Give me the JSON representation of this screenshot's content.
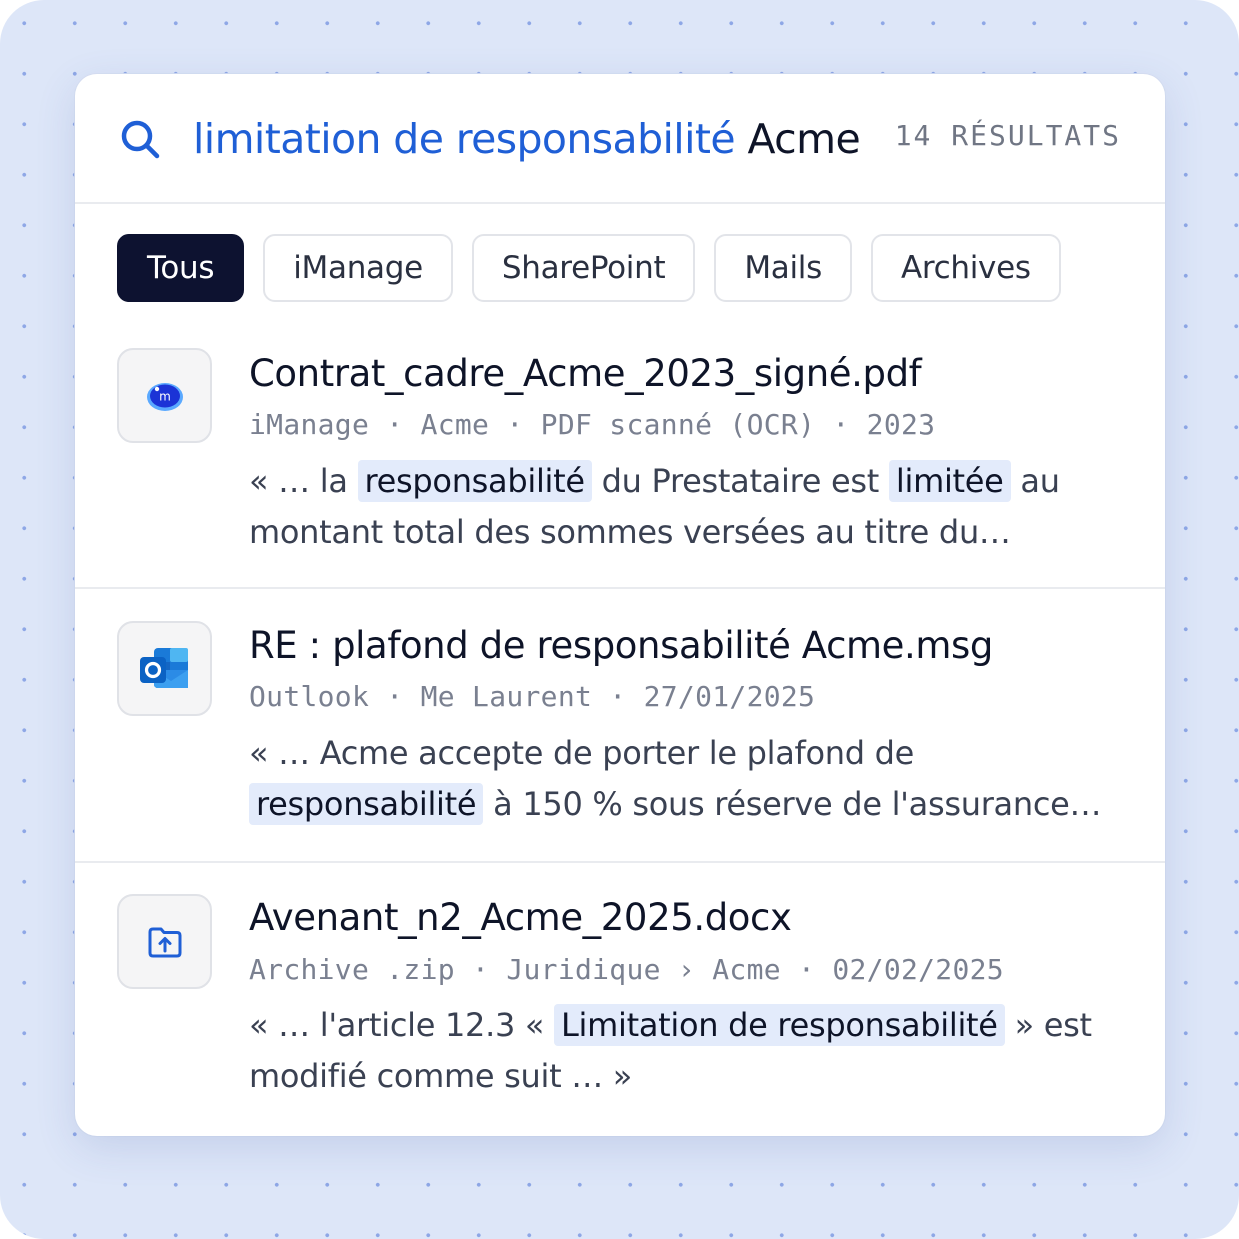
{
  "search": {
    "query_highlighted": "limitation de responsabilité",
    "query_rest": "Acme",
    "result_count": "14 RÉSULTATS"
  },
  "filters": [
    "Tous",
    "iManage",
    "SharePoint",
    "Mails",
    "Archives"
  ],
  "active_filter": "Tous",
  "results": [
    {
      "icon": "imanage-icon",
      "title": "Contrat_cadre_Acme_2023_signé.pdf",
      "meta": "iManage · Acme · PDF scanné (OCR) · 2023",
      "snippet": {
        "t1": "« … la ",
        "h1": "responsabilité",
        "t2": " du Prestataire est ",
        "h2": "limitée",
        "t3": " au montant total des sommes versées au titre du…"
      }
    },
    {
      "icon": "outlook-icon",
      "title": "RE : plafond de responsabilité Acme.msg",
      "meta": "Outlook · Me Laurent · 27/01/2025",
      "snippet": {
        "t1": "« … Acme accepte de porter le plafond de ",
        "h1": "responsabilité",
        "t2": " à 150 % sous réserve de l'assurance…"
      }
    },
    {
      "icon": "folder-upload-icon",
      "title": "Avenant_n2_Acme_2025.docx",
      "meta": "Archive .zip · Juridique › Acme · 02/02/2025",
      "snippet": {
        "t1": "« … l'article 12.3 « ",
        "h1": "Limitation de responsabilité",
        "t2": " » est modifié comme suit … »"
      }
    }
  ],
  "colors": {
    "accent": "#1f5fd6",
    "active_chip": "#0d1230",
    "highlight_bg": "#e3ebfb",
    "background": "#dde6f8"
  }
}
